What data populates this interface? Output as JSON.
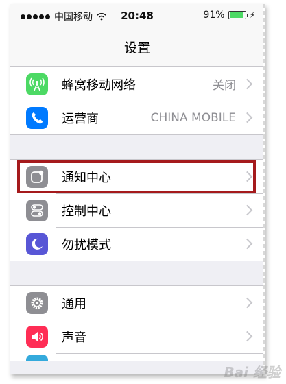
{
  "status_bar": {
    "carrier": "中国移动",
    "time": "20:48",
    "battery": "91%",
    "battery_level": 0.91
  },
  "nav": {
    "title": "设置"
  },
  "groups": [
    [
      {
        "label": "蜂窝移动网络",
        "value": "关闭",
        "icon": "cellular-antenna-icon",
        "color": "#4cd964"
      },
      {
        "label": "运营商",
        "value": "CHINA MOBILE",
        "icon": "phone-icon",
        "color": "#007aff"
      }
    ],
    [
      {
        "label": "通知中心",
        "value": "",
        "icon": "notification-center-icon",
        "color": "#8e8e93"
      },
      {
        "label": "控制中心",
        "value": "",
        "icon": "control-center-icon",
        "color": "#8e8e93"
      },
      {
        "label": "勿扰模式",
        "value": "",
        "icon": "moon-icon",
        "color": "#5856d6"
      }
    ],
    [
      {
        "label": "通用",
        "value": "",
        "icon": "gear-icon",
        "color": "#8e8e93"
      },
      {
        "label": "声音",
        "value": "",
        "icon": "speaker-icon",
        "color": "#ff2d55"
      }
    ]
  ],
  "highlight_color": "#a51a1c",
  "watermark": "Bai 经验"
}
